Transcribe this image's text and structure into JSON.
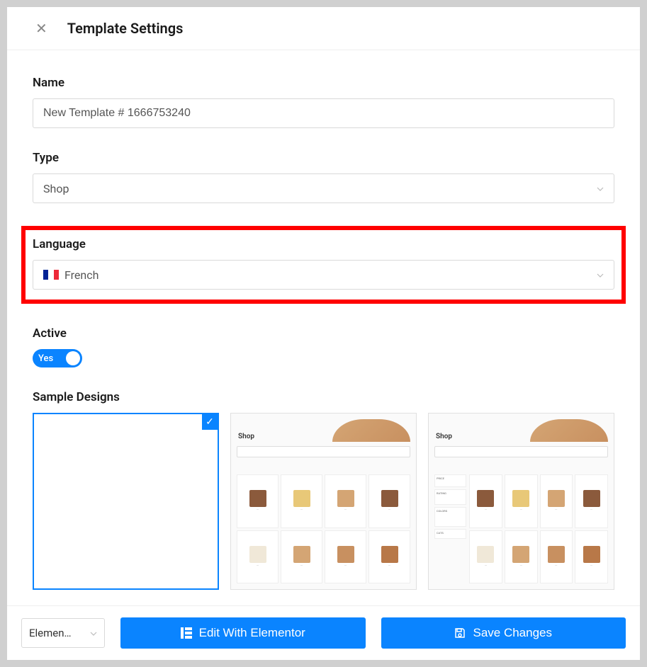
{
  "header": {
    "title": "Template Settings"
  },
  "form": {
    "name": {
      "label": "Name",
      "value": "New Template # 1666753240"
    },
    "type": {
      "label": "Type",
      "value": "Shop"
    },
    "language": {
      "label": "Language",
      "value": "French",
      "flag": {
        "colors": [
          "#002395",
          "#ffffff",
          "#ed2939"
        ]
      }
    },
    "active": {
      "label": "Active",
      "state_label": "Yes",
      "enabled": true
    },
    "sample_designs": {
      "label": "Sample Designs",
      "options": [
        {
          "id": "blank",
          "selected": true,
          "title": ""
        },
        {
          "id": "shop-grid",
          "selected": false,
          "title": "Shop"
        },
        {
          "id": "shop-sidebar",
          "selected": false,
          "title": "Shop"
        }
      ]
    }
  },
  "footer": {
    "builder_select": "Elemen…",
    "edit_label": "Edit With Elementor",
    "save_label": "Save Changes"
  },
  "colors": {
    "primary": "#0a84ff",
    "highlight": "#ff0000"
  }
}
